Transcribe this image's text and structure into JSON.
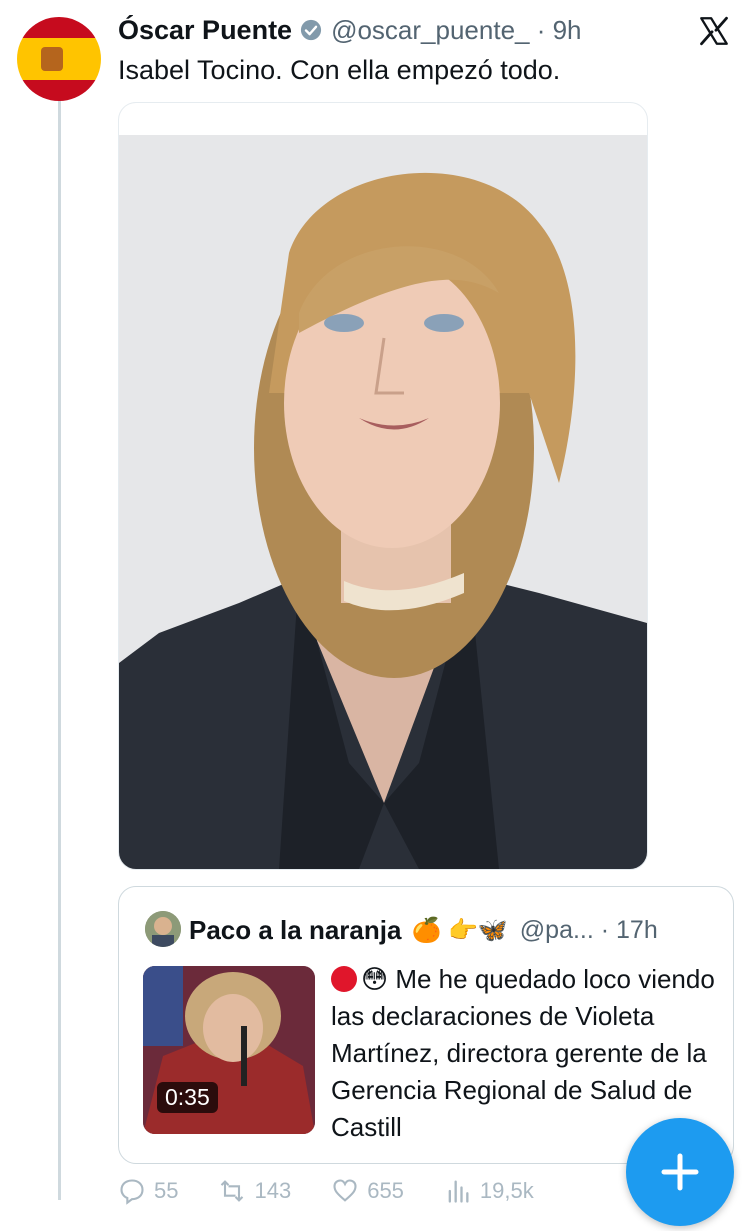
{
  "tweet": {
    "author_name": "Óscar Puente",
    "handle_time": "@oscar_puente_ · 9h",
    "text": "Isabel Tocino. Con ella empezó todo."
  },
  "quote": {
    "author_name": "Paco a la naranja",
    "author_emojis": "🍊 👉🦋",
    "handle_time": "@pa... · 17h",
    "emoji_after_dot": "😳",
    "text": "Me he quedado loco viendo las declaraciones de Violeta Martínez, directora gerente de la Gerencia Regional de Salud de Castill",
    "video_duration": "0:35"
  },
  "actions": {
    "replies": "55",
    "reposts": "143",
    "likes": "655",
    "views": "19,5k"
  },
  "colors": {
    "accent": "#1d9bf0",
    "text": "#0f1419",
    "secondary": "#536471"
  },
  "icons": [
    "verified-icon",
    "x-logo-icon",
    "reply-icon",
    "repost-icon",
    "like-icon",
    "views-icon",
    "compose-plus-icon"
  ]
}
